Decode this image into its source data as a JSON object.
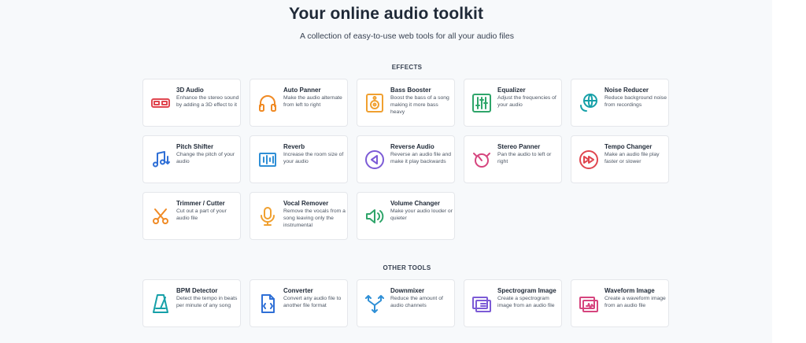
{
  "header": {
    "title": "Your online audio toolkit",
    "subtitle": "A collection of easy-to-use web tools for all your audio files"
  },
  "effects": {
    "heading": "EFFECTS",
    "tools": [
      {
        "name": "3D Audio",
        "description": "Enhance the stereo sound by adding a 3D effect to it",
        "icon": "3d-glasses-icon",
        "color": "#e0464f"
      },
      {
        "name": "Auto Panner",
        "description": "Make the audio alternate from left to right",
        "icon": "headphones-icon",
        "color": "#f08a24"
      },
      {
        "name": "Bass Booster",
        "description": "Boost the bass of a song making it more bass heavy",
        "icon": "speaker-icon",
        "color": "#f0a030"
      },
      {
        "name": "Equalizer",
        "description": "Adjust the frequencies of your audio",
        "icon": "equalizer-sliders-icon",
        "color": "#2fa56a"
      },
      {
        "name": "Noise Reducer",
        "description": "Reduce background noise from recordings",
        "icon": "globe-noise-icon",
        "color": "#16a0a8"
      },
      {
        "name": "Pitch Shifter",
        "description": "Change the pitch of your audio",
        "icon": "music-note-arrows-icon",
        "color": "#2f6fd6"
      },
      {
        "name": "Reverb",
        "description": "Increase the room size of your audio",
        "icon": "room-reverb-icon",
        "color": "#2f8fd6"
      },
      {
        "name": "Reverse Audio",
        "description": "Reverse an audio file and make it play backwards",
        "icon": "reverse-play-icon",
        "color": "#7c5bd6"
      },
      {
        "name": "Stereo Panner",
        "description": "Pan the audio to left or right",
        "icon": "pan-knob-icon",
        "color": "#d6457e"
      },
      {
        "name": "Tempo Changer",
        "description": "Make an audio file play faster or slower",
        "icon": "fast-forward-icon",
        "color": "#e0464f"
      },
      {
        "name": "Trimmer / Cutter",
        "description": "Cut out a part of your audio file",
        "icon": "scissors-icon",
        "color": "#f08a24"
      },
      {
        "name": "Vocal Remover",
        "description": "Remove the vocals from a song leaving only the instrumental",
        "icon": "microphone-icon",
        "color": "#f0a030"
      },
      {
        "name": "Volume Changer",
        "description": "Make your audio louder or quieter",
        "icon": "volume-icon",
        "color": "#2fa56a"
      }
    ]
  },
  "other_tools": {
    "heading": "OTHER TOOLS",
    "tools": [
      {
        "name": "BPM Detector",
        "description": "Detect the tempo in beats per minute of any song",
        "icon": "metronome-icon",
        "color": "#16a0a8"
      },
      {
        "name": "Converter",
        "description": "Convert any audio file to another file format",
        "icon": "file-convert-icon",
        "color": "#2f6fd6"
      },
      {
        "name": "Downmixer",
        "description": "Reduce the amount of audio channels",
        "icon": "downmix-arrows-icon",
        "color": "#2f8fd6"
      },
      {
        "name": "Spectrogram Image",
        "description": "Create a spectrogram image from an audio file",
        "icon": "spectrogram-image-icon",
        "color": "#7c5bd6"
      },
      {
        "name": "Waveform Image",
        "description": "Create a waveform image from an audio file",
        "icon": "waveform-image-icon",
        "color": "#d6457e"
      }
    ]
  }
}
